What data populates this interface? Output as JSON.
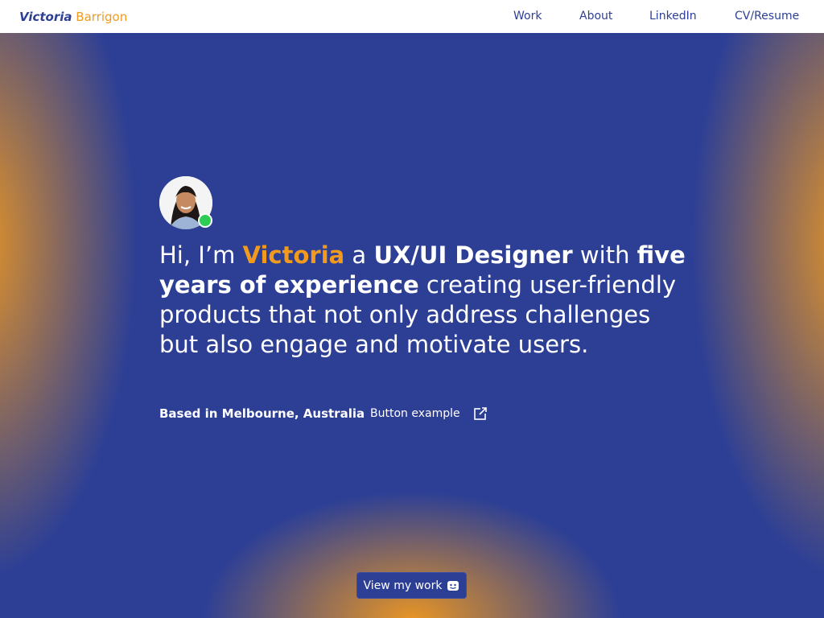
{
  "brand": {
    "first": "Victoria",
    "last": "Barrigon"
  },
  "nav": {
    "work": "Work",
    "about": "About",
    "linkedin": "LinkedIn",
    "cv": "CV/Resume"
  },
  "hero": {
    "intro": {
      "p1": "Hi, I’m ",
      "name": "Victoria",
      "p2": " a ",
      "role": "UX/UI Designer",
      "p3": " with ",
      "exp": "five years of experience",
      "p4": " creating user-friendly products that not only address challenges but also engage and motivate users."
    },
    "location": "Based in Melbourne, Australia",
    "button_example": "Button example",
    "cta": "View my work"
  },
  "icons": {
    "external_link": "external-link-icon",
    "cta": "smile-icon",
    "status": "online-status-dot"
  },
  "colors": {
    "background": "#2d3f95",
    "accent": "#f29a1e",
    "nav_text": "#2d3f95",
    "status": "#2ecc55"
  }
}
